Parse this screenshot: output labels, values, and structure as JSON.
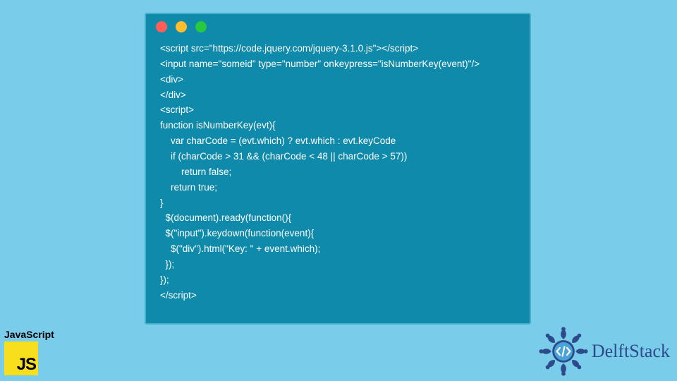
{
  "code_lines": [
    "<script src=\"https://code.jquery.com/jquery-3.1.0.js\"></script>",
    "<input name=\"someid\" type=\"number\" onkeypress=\"isNumberKey(event)\"/>",
    "<div>",
    "</div>",
    "<script>",
    "function isNumberKey(evt){",
    "    var charCode = (evt.which) ? evt.which : evt.keyCode",
    "    if (charCode > 31 && (charCode < 48 || charCode > 57))",
    "        return false;",
    "    return true;",
    "}",
    "  $(document).ready(function(){",
    "  $(\"input\").keydown(function(event){",
    "    $(\"div\").html(\"Key: \" + event.which);",
    "  });",
    "});",
    "</script>"
  ],
  "js_badge": {
    "label": "JavaScript",
    "logo_text": "JS"
  },
  "brand": {
    "name": "DelftStack"
  },
  "dots": {
    "red": "#ff5f56",
    "yellow": "#ffbd2e",
    "green": "#27c93f"
  }
}
